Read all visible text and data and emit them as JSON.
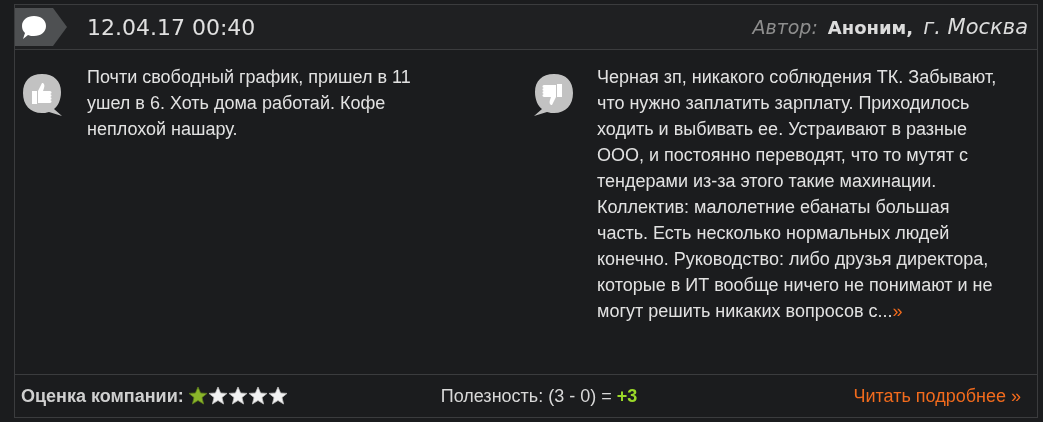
{
  "header": {
    "date": "12.04.17 00:40",
    "author_label": "Автор:",
    "author_name": "Аноним,",
    "city": "г. Москва"
  },
  "pros": {
    "text": "Почти свободный график, пришел в 11 ушел в 6. Хоть дома работай. Кофе неплохой нашару."
  },
  "cons": {
    "text": "Черная зп, никакого соблюдения ТК. Забывают, что нужно заплатить зарплату. Приходилось ходить и выбивать ее. Устраивают в разные ООО, и постоянно переводят, что то мутят с тендерами из-за этого такие махинации. Коллектив: малолетние ебанаты большая часть. Есть несколько нормальных людей конечно. Руководство: либо друзья директора, которые в ИТ вообще ничего не понимают и не могут решить никаких вопросов с...",
    "more": "»"
  },
  "footer": {
    "rating_label": "Оценка компании:",
    "stars": 1,
    "usefulness": "Полезность: (3 - 0) =",
    "score": "+3",
    "read_more": "Читать подробнее »"
  }
}
